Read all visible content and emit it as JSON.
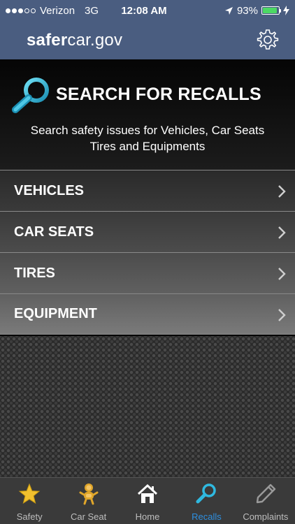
{
  "status_bar": {
    "carrier": "Verizon",
    "network": "3G",
    "time": "12:08 AM",
    "battery": "93%",
    "battery_level": 0.93,
    "battery_color": "#4cd964"
  },
  "header": {
    "logo_bold": "safer",
    "logo_light": "car.gov",
    "settings_icon": "gear-icon"
  },
  "search": {
    "title": "SEARCH FOR RECALLS",
    "subtitle_line1": "Search safety issues for Vehicles, Car Seats",
    "subtitle_line2": "Tires and Equipments",
    "icon": "magnifier-icon",
    "accent_color": "#26b6d9"
  },
  "menu": {
    "items": [
      {
        "label": "VEHICLES"
      },
      {
        "label": "CAR SEATS"
      },
      {
        "label": "TIRES"
      },
      {
        "label": "EQUIPMENT"
      }
    ]
  },
  "tabs": [
    {
      "label": "Safety",
      "icon": "star-icon"
    },
    {
      "label": "Car Seat",
      "icon": "baby-icon"
    },
    {
      "label": "Home",
      "icon": "house-icon"
    },
    {
      "label": "Recalls",
      "icon": "magnifier-icon",
      "active": true
    },
    {
      "label": "Complaints",
      "icon": "pencil-icon"
    }
  ],
  "colors": {
    "nav_bg": "#4a5d80",
    "active_tab": "#2d8fe0",
    "star": "#f2c12e"
  }
}
